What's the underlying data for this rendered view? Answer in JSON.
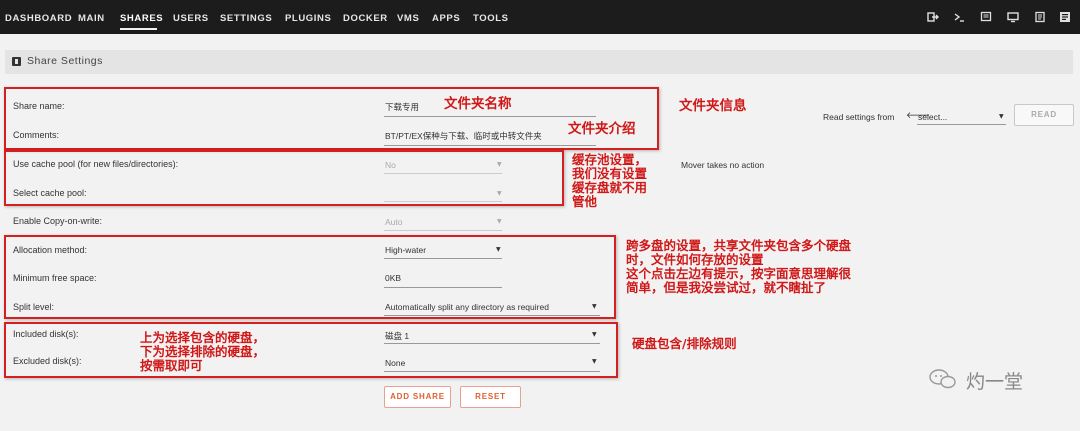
{
  "nav": {
    "items": [
      "DASHBOARD",
      "MAIN",
      "SHARES",
      "USERS",
      "SETTINGS",
      "PLUGINS",
      "DOCKER",
      "VMS",
      "APPS",
      "TOOLS"
    ],
    "active": "SHARES",
    "icons": [
      "logout-icon",
      "terminal-icon",
      "feedback-icon",
      "monitor-icon",
      "log-icon",
      "help-icon"
    ]
  },
  "section": {
    "title": "Share Settings"
  },
  "form": {
    "share_name": {
      "label": "Share name:",
      "value": "下载专用"
    },
    "comments": {
      "label": "Comments:",
      "value": "BT/PT/EX保种与下载、临时或中转文件夹"
    },
    "use_cache": {
      "label": "Use cache pool (for new files/directories):",
      "value": "No"
    },
    "select_cache": {
      "label": "Select cache pool:",
      "value": ""
    },
    "copy_on_write": {
      "label": "Enable Copy-on-write:",
      "value": "Auto"
    },
    "allocation": {
      "label": "Allocation method:",
      "value": "High-water"
    },
    "min_free": {
      "label": "Minimum free space:",
      "value": "0KB"
    },
    "split_level": {
      "label": "Split level:",
      "value": "Automatically split any directory as required"
    },
    "included": {
      "label": "Included disk(s):",
      "value": "磁盘 1"
    },
    "excluded": {
      "label": "Excluded disk(s):",
      "value": "None"
    },
    "mover_note": "Mover takes no action"
  },
  "read_settings": {
    "label": "Read settings from",
    "select": "select...",
    "button": "READ"
  },
  "buttons": {
    "add_share": "ADD SHARE",
    "reset": "RESET"
  },
  "annotations": {
    "folder_name": "文件夹名称",
    "folder_desc": "文件夹介绍",
    "folder_info": "文件夹信息",
    "cache_lines": [
      "缓存池设置，",
      "我们没有设置",
      "缓存盘就不用",
      "管他"
    ],
    "split_lines": [
      "跨多盘的设置，共享文件夹包含多个硬盘",
      "时，文件如何存放的设置",
      "这个点击左边有提示，按字面意思理解很",
      "简单，但是我没尝试过，就不瞎扯了"
    ],
    "disk_lines": [
      "上为选择包含的硬盘，",
      "下为选择排除的硬盘，",
      "按需取即可"
    ],
    "disk_rule": "硬盘包含/排除规则"
  },
  "watermark": "灼一堂"
}
